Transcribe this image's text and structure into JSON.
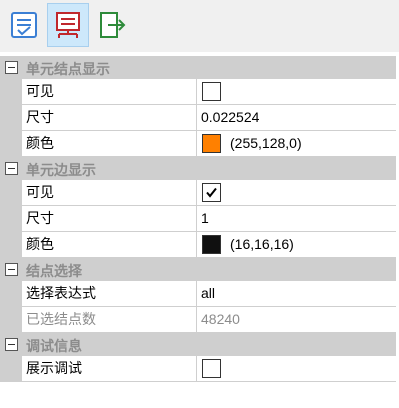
{
  "toolbar": {
    "buttons": [
      {
        "icon": "checklist-icon"
      },
      {
        "icon": "node-tree-icon"
      },
      {
        "icon": "export-icon"
      }
    ]
  },
  "sections": [
    {
      "title": "单元结点显示",
      "rows": [
        {
          "label": "可见",
          "checked": false
        },
        {
          "label": "尺寸",
          "value": "0.022524"
        },
        {
          "label": "颜色",
          "value": "(255,128,0)",
          "color": "#ff8000"
        }
      ]
    },
    {
      "title": "单元边显示",
      "rows": [
        {
          "label": "可见",
          "checked": true
        },
        {
          "label": "尺寸",
          "value": "1"
        },
        {
          "label": "颜色",
          "value": "(16,16,16)",
          "color": "#101010"
        }
      ]
    },
    {
      "title": "结点选择",
      "rows": [
        {
          "label": "选择表达式",
          "value": "all"
        },
        {
          "label": "已选结点数",
          "value": "48240"
        }
      ]
    },
    {
      "title": "调试信息",
      "rows": [
        {
          "label": "展示调试",
          "checked": false
        }
      ]
    }
  ]
}
